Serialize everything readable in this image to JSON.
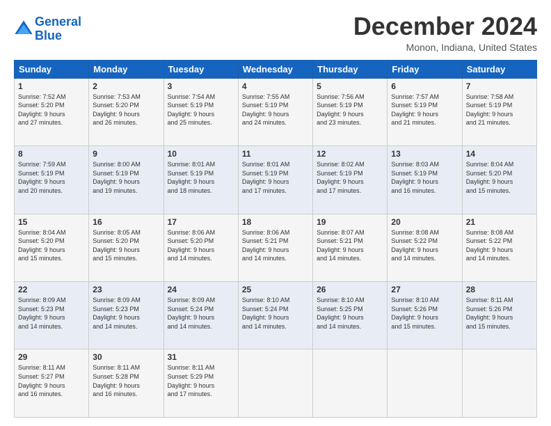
{
  "logo": {
    "line1": "General",
    "line2": "Blue"
  },
  "title": "December 2024",
  "location": "Monon, Indiana, United States",
  "days_of_week": [
    "Sunday",
    "Monday",
    "Tuesday",
    "Wednesday",
    "Thursday",
    "Friday",
    "Saturday"
  ],
  "weeks": [
    [
      {
        "day": "1",
        "info": "Sunrise: 7:52 AM\nSunset: 5:20 PM\nDaylight: 9 hours\nand 27 minutes."
      },
      {
        "day": "2",
        "info": "Sunrise: 7:53 AM\nSunset: 5:20 PM\nDaylight: 9 hours\nand 26 minutes."
      },
      {
        "day": "3",
        "info": "Sunrise: 7:54 AM\nSunset: 5:19 PM\nDaylight: 9 hours\nand 25 minutes."
      },
      {
        "day": "4",
        "info": "Sunrise: 7:55 AM\nSunset: 5:19 PM\nDaylight: 9 hours\nand 24 minutes."
      },
      {
        "day": "5",
        "info": "Sunrise: 7:56 AM\nSunset: 5:19 PM\nDaylight: 9 hours\nand 23 minutes."
      },
      {
        "day": "6",
        "info": "Sunrise: 7:57 AM\nSunset: 5:19 PM\nDaylight: 9 hours\nand 21 minutes."
      },
      {
        "day": "7",
        "info": "Sunrise: 7:58 AM\nSunset: 5:19 PM\nDaylight: 9 hours\nand 21 minutes."
      }
    ],
    [
      {
        "day": "8",
        "info": "Sunrise: 7:59 AM\nSunset: 5:19 PM\nDaylight: 9 hours\nand 20 minutes."
      },
      {
        "day": "9",
        "info": "Sunrise: 8:00 AM\nSunset: 5:19 PM\nDaylight: 9 hours\nand 19 minutes."
      },
      {
        "day": "10",
        "info": "Sunrise: 8:01 AM\nSunset: 5:19 PM\nDaylight: 9 hours\nand 18 minutes."
      },
      {
        "day": "11",
        "info": "Sunrise: 8:01 AM\nSunset: 5:19 PM\nDaylight: 9 hours\nand 17 minutes."
      },
      {
        "day": "12",
        "info": "Sunrise: 8:02 AM\nSunset: 5:19 PM\nDaylight: 9 hours\nand 17 minutes."
      },
      {
        "day": "13",
        "info": "Sunrise: 8:03 AM\nSunset: 5:19 PM\nDaylight: 9 hours\nand 16 minutes."
      },
      {
        "day": "14",
        "info": "Sunrise: 8:04 AM\nSunset: 5:20 PM\nDaylight: 9 hours\nand 15 minutes."
      }
    ],
    [
      {
        "day": "15",
        "info": "Sunrise: 8:04 AM\nSunset: 5:20 PM\nDaylight: 9 hours\nand 15 minutes."
      },
      {
        "day": "16",
        "info": "Sunrise: 8:05 AM\nSunset: 5:20 PM\nDaylight: 9 hours\nand 15 minutes."
      },
      {
        "day": "17",
        "info": "Sunrise: 8:06 AM\nSunset: 5:20 PM\nDaylight: 9 hours\nand 14 minutes."
      },
      {
        "day": "18",
        "info": "Sunrise: 8:06 AM\nSunset: 5:21 PM\nDaylight: 9 hours\nand 14 minutes."
      },
      {
        "day": "19",
        "info": "Sunrise: 8:07 AM\nSunset: 5:21 PM\nDaylight: 9 hours\nand 14 minutes."
      },
      {
        "day": "20",
        "info": "Sunrise: 8:08 AM\nSunset: 5:22 PM\nDaylight: 9 hours\nand 14 minutes."
      },
      {
        "day": "21",
        "info": "Sunrise: 8:08 AM\nSunset: 5:22 PM\nDaylight: 9 hours\nand 14 minutes."
      }
    ],
    [
      {
        "day": "22",
        "info": "Sunrise: 8:09 AM\nSunset: 5:23 PM\nDaylight: 9 hours\nand 14 minutes."
      },
      {
        "day": "23",
        "info": "Sunrise: 8:09 AM\nSunset: 5:23 PM\nDaylight: 9 hours\nand 14 minutes."
      },
      {
        "day": "24",
        "info": "Sunrise: 8:09 AM\nSunset: 5:24 PM\nDaylight: 9 hours\nand 14 minutes."
      },
      {
        "day": "25",
        "info": "Sunrise: 8:10 AM\nSunset: 5:24 PM\nDaylight: 9 hours\nand 14 minutes."
      },
      {
        "day": "26",
        "info": "Sunrise: 8:10 AM\nSunset: 5:25 PM\nDaylight: 9 hours\nand 14 minutes."
      },
      {
        "day": "27",
        "info": "Sunrise: 8:10 AM\nSunset: 5:26 PM\nDaylight: 9 hours\nand 15 minutes."
      },
      {
        "day": "28",
        "info": "Sunrise: 8:11 AM\nSunset: 5:26 PM\nDaylight: 9 hours\nand 15 minutes."
      }
    ],
    [
      {
        "day": "29",
        "info": "Sunrise: 8:11 AM\nSunset: 5:27 PM\nDaylight: 9 hours\nand 16 minutes."
      },
      {
        "day": "30",
        "info": "Sunrise: 8:11 AM\nSunset: 5:28 PM\nDaylight: 9 hours\nand 16 minutes."
      },
      {
        "day": "31",
        "info": "Sunrise: 8:11 AM\nSunset: 5:29 PM\nDaylight: 9 hours\nand 17 minutes."
      },
      {
        "day": "",
        "info": ""
      },
      {
        "day": "",
        "info": ""
      },
      {
        "day": "",
        "info": ""
      },
      {
        "day": "",
        "info": ""
      }
    ]
  ]
}
